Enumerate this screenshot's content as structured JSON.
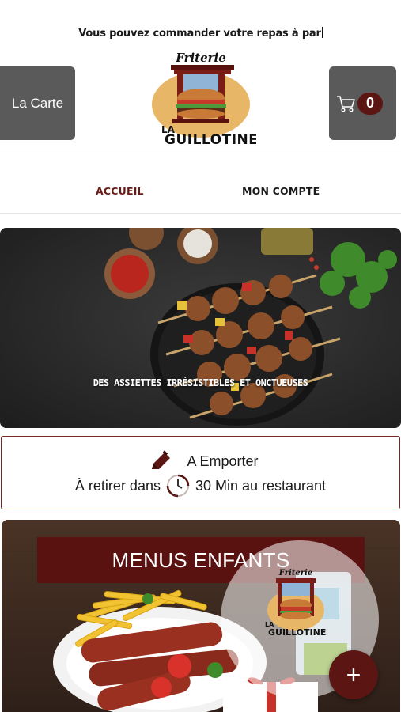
{
  "ticker": {
    "text": "Vous pouvez commander votre repas à par"
  },
  "header": {
    "menu_button_label": "La Carte",
    "cart_count": "0",
    "logo": {
      "top_text": "Friterie",
      "la_text": "LA",
      "name_text": "GUILLOTINE"
    }
  },
  "nav": {
    "tabs": [
      {
        "label": "ACCUEIL",
        "active": true
      },
      {
        "label": "MON COMPTE",
        "active": false
      }
    ]
  },
  "hero": {
    "caption": "DES ASSIETTES IRRÉSISTIBLES ET ONCTUEUSES"
  },
  "order_info": {
    "mode_label": "A Emporter",
    "pickup_prefix": "À retirer dans",
    "pickup_suffix": "30 Min au restaurant"
  },
  "menu_category": {
    "title": "MENUS ENFANTS"
  },
  "promo": {
    "top_text": "Friterie",
    "la_text": "LA",
    "name_text": "GUILLOTINE"
  },
  "fab": {
    "label": "+"
  },
  "colors": {
    "brand": "#5b1614",
    "button_gray": "#5a5a5a",
    "active_tab": "#6b1a16"
  }
}
